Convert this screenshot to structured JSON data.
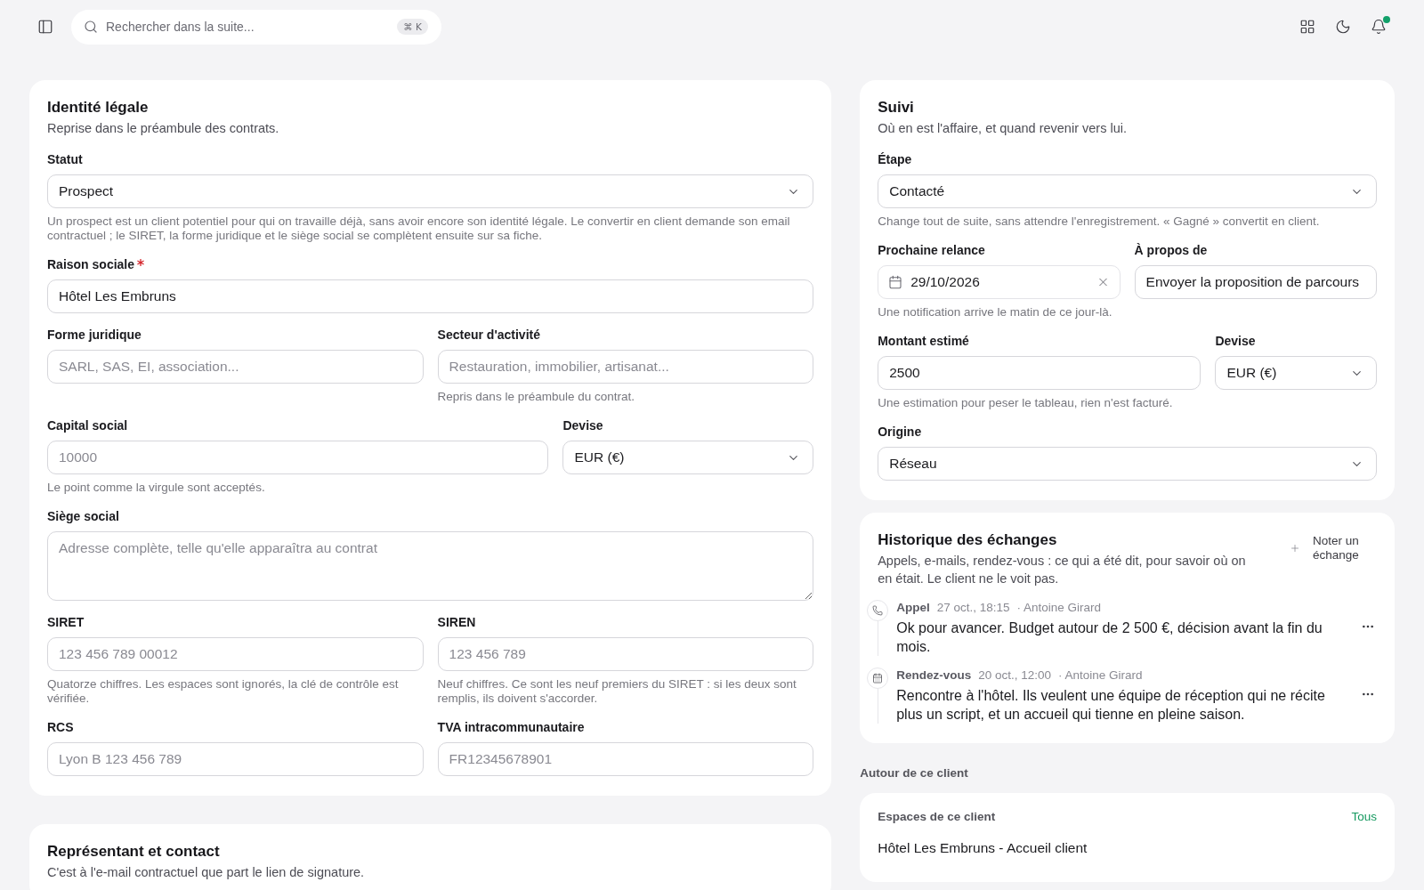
{
  "topbar": {
    "search": {
      "placeholder": "Rechercher dans la suite...",
      "shortcut": "⌘ K"
    },
    "notifications": {
      "unread": true
    }
  },
  "legal_identity": {
    "title": "Identité légale",
    "subtitle": "Reprise dans le préambule des contrats.",
    "rows": [
      [
        {
          "kind": "select",
          "label": "Statut",
          "value": "Prospect",
          "required": false,
          "help": "Un prospect est un client potentiel pour qui on travaille déjà, sans avoir encore son identité légale. Le convertir en client demande son email contractuel ; le SIRET, la forme juridique et le siège social se complètent ensuite sur sa fiche."
        }
      ],
      [
        {
          "kind": "input",
          "label": "Raison sociale",
          "value": "Hôtel Les Embruns",
          "required": true
        }
      ],
      [
        {
          "kind": "input",
          "label": "Forme juridique",
          "placeholder": "SARL, SAS, EI, association...",
          "required": false
        },
        {
          "kind": "input",
          "label": "Secteur d'activité",
          "placeholder": "Restauration, immobilier, artisanat...",
          "required": false,
          "help": "Repris dans le préambule du contrat."
        }
      ],
      [
        {
          "kind": "input",
          "label": "Capital social",
          "placeholder": "10000",
          "required": false,
          "help": "Le point comme la virgule sont acceptés."
        },
        {
          "kind": "select",
          "label": "Devise",
          "value": "EUR (€)",
          "required": false
        }
      ],
      [
        {
          "kind": "textarea",
          "label": "Siège social",
          "placeholder": "Adresse complète, telle qu'elle apparaîtra au contrat",
          "required": false
        }
      ],
      [
        {
          "kind": "input",
          "label": "SIRET",
          "placeholder": "123 456 789 00012",
          "required": false,
          "help": "Quatorze chiffres. Les espaces sont ignorés, la clé de contrôle est vérifiée."
        },
        {
          "kind": "input",
          "label": "SIREN",
          "placeholder": "123 456 789",
          "required": false,
          "help": "Neuf chiffres. Ce sont les neuf premiers du SIRET : si les deux sont remplis, ils doivent s'accorder."
        }
      ],
      [
        {
          "kind": "input",
          "label": "RCS",
          "placeholder": "Lyon B 123 456 789",
          "required": false
        },
        {
          "kind": "input",
          "label": "TVA intracommunautaire",
          "placeholder": "FR12345678901",
          "required": false
        }
      ]
    ]
  },
  "representative": {
    "title": "Représentant et contact",
    "subtitle": "C'est à l'e-mail contractuel que part le lien de signature."
  },
  "tracking": {
    "title": "Suivi",
    "subtitle": "Où en est l'affaire, et quand revenir vers lui.",
    "rows": [
      [
        {
          "kind": "select",
          "label": "Étape",
          "value": "Contacté",
          "required": false,
          "help": "Change tout de suite, sans attendre l'enregistrement. « Gagné » convertit en client."
        }
      ],
      [
        {
          "kind": "date",
          "label": "Prochaine relance",
          "value": "29/10/2026",
          "required": false,
          "help": "Une notification arrive le matin de ce jour-là."
        },
        {
          "kind": "input",
          "label": "À propos de",
          "value": "Envoyer la proposition de parcours",
          "required": false
        }
      ],
      [
        {
          "kind": "input",
          "label": "Montant estimé",
          "value": "2500",
          "required": false,
          "help": "Une estimation pour peser le tableau, rien n'est facturé."
        },
        {
          "kind": "select",
          "label": "Devise",
          "value": "EUR (€)",
          "required": false
        }
      ],
      [
        {
          "kind": "select",
          "label": "Origine",
          "value": "Réseau",
          "required": false
        }
      ]
    ]
  },
  "history": {
    "title": "Historique des échanges",
    "subtitle": "Appels, e-mails, rendez-vous : ce qui a été dit, pour savoir où on en était. Le client ne le voit pas.",
    "add_button": "Noter un échange",
    "entries": [
      {
        "kind": "call",
        "type": "Appel",
        "date": "27 oct., 18:15",
        "author": "· Antoine Girard",
        "text": "Ok pour avancer. Budget autour de 2 500 €, décision avant la fin du mois."
      },
      {
        "kind": "meeting",
        "type": "Rendez-vous",
        "date": "20 oct., 12:00",
        "author": "· Antoine Girard",
        "text": "Rencontre à l'hôtel. Ils veulent une équipe de réception qui ne récite plus un script, et un accueil qui tienne en pleine saison."
      }
    ]
  },
  "related": {
    "heading": "Autour de ce client",
    "spaces": {
      "title": "Espaces de ce client",
      "link": "Tous",
      "items": [
        "Hôtel Les Embruns - Accueil client"
      ]
    }
  }
}
